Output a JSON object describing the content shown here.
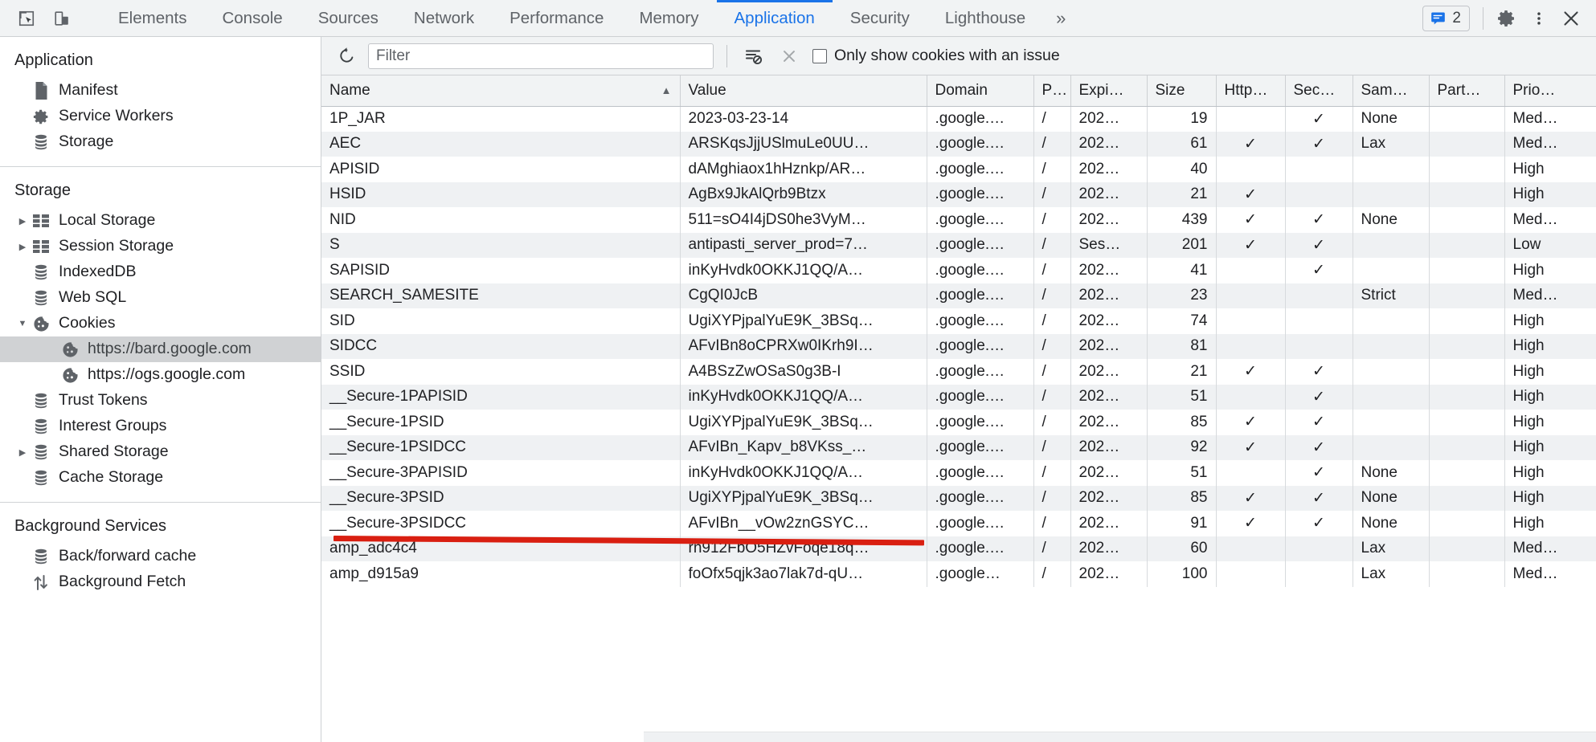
{
  "toolbar": {
    "inspect_icon": "inspect-cursor-icon",
    "device_icon": "device-toolbar-icon",
    "tabs": [
      {
        "label": "Elements",
        "selected": false
      },
      {
        "label": "Console",
        "selected": false
      },
      {
        "label": "Sources",
        "selected": false
      },
      {
        "label": "Network",
        "selected": false
      },
      {
        "label": "Performance",
        "selected": false
      },
      {
        "label": "Memory",
        "selected": false
      },
      {
        "label": "Application",
        "selected": true
      },
      {
        "label": "Security",
        "selected": false
      },
      {
        "label": "Lighthouse",
        "selected": false
      }
    ],
    "more_tabs": "»",
    "issues_count": "2",
    "settings_icon": "gear-icon",
    "menu_icon": "kebab-menu-icon",
    "close_icon": "close-icon",
    "accent_color": "#1a73e8"
  },
  "sidebar": {
    "groups": [
      {
        "title": "Application",
        "items": [
          {
            "label": "Manifest",
            "icon": "manifest-document-icon",
            "indent": 1,
            "twisty": "",
            "selected": false
          },
          {
            "label": "Service Workers",
            "icon": "gear-icon",
            "indent": 1,
            "twisty": "",
            "selected": false
          },
          {
            "label": "Storage",
            "icon": "database-icon",
            "indent": 1,
            "twisty": "",
            "selected": false
          }
        ]
      },
      {
        "title": "Storage",
        "items": [
          {
            "label": "Local Storage",
            "icon": "table-grid-icon",
            "indent": 1,
            "twisty": "▶",
            "selected": false
          },
          {
            "label": "Session Storage",
            "icon": "table-grid-icon",
            "indent": 1,
            "twisty": "▶",
            "selected": false
          },
          {
            "label": "IndexedDB",
            "icon": "database-icon",
            "indent": 1,
            "twisty": "",
            "selected": false
          },
          {
            "label": "Web SQL",
            "icon": "database-icon",
            "indent": 1,
            "twisty": "",
            "selected": false
          },
          {
            "label": "Cookies",
            "icon": "cookie-icon",
            "indent": 1,
            "twisty": "▼",
            "selected": false
          },
          {
            "label": "https://bard.google.com",
            "icon": "cookie-icon",
            "indent": 2,
            "twisty": "",
            "selected": true
          },
          {
            "label": "https://ogs.google.com",
            "icon": "cookie-icon",
            "indent": 2,
            "twisty": "",
            "selected": false
          },
          {
            "label": "Trust Tokens",
            "icon": "database-icon",
            "indent": 1,
            "twisty": "",
            "selected": false
          },
          {
            "label": "Interest Groups",
            "icon": "database-icon",
            "indent": 1,
            "twisty": "",
            "selected": false
          },
          {
            "label": "Shared Storage",
            "icon": "database-icon",
            "indent": 1,
            "twisty": "▶",
            "selected": false
          },
          {
            "label": "Cache Storage",
            "icon": "database-icon",
            "indent": 1,
            "twisty": "",
            "selected": false
          }
        ]
      },
      {
        "title": "Background Services",
        "items": [
          {
            "label": "Back/forward cache",
            "icon": "database-icon",
            "indent": 1,
            "twisty": "",
            "selected": false
          },
          {
            "label": "Background Fetch",
            "icon": "updown-arrows-icon",
            "indent": 1,
            "twisty": "",
            "selected": false
          }
        ]
      }
    ]
  },
  "filter_bar": {
    "refresh_icon": "refresh-icon",
    "filter_placeholder": "Filter",
    "filter_value": "",
    "clear_filtered_icon": "clear-filtered-cookies-icon",
    "clear_all_icon": "clear-all-cookies-icon",
    "only_issues_label": "Only show cookies with an issue",
    "only_issues_checked": false
  },
  "table": {
    "sort_column": "Name",
    "sort_direction": "asc",
    "sort_arrow": "▲",
    "columns": [
      {
        "label": "Name",
        "key": "name",
        "align": "left"
      },
      {
        "label": "Value",
        "key": "value",
        "align": "left"
      },
      {
        "label": "Domain",
        "key": "domain",
        "align": "left"
      },
      {
        "label": "P…",
        "key": "path",
        "align": "left"
      },
      {
        "label": "Expi…",
        "key": "expires",
        "align": "left"
      },
      {
        "label": "Size",
        "key": "size",
        "align": "right"
      },
      {
        "label": "Http…",
        "key": "httponly",
        "align": "center"
      },
      {
        "label": "Sec…",
        "key": "secure",
        "align": "center"
      },
      {
        "label": "Sam…",
        "key": "samesite",
        "align": "left"
      },
      {
        "label": "Part…",
        "key": "partition",
        "align": "left"
      },
      {
        "label": "Prio…",
        "key": "priority",
        "align": "left"
      }
    ],
    "rows": [
      {
        "name": "1P_JAR",
        "value": "2023-03-23-14",
        "domain": ".google.…",
        "path": "/",
        "expires": "202…",
        "size": "19",
        "httponly": "",
        "secure": "✓",
        "samesite": "None",
        "partition": "",
        "priority": "Med…"
      },
      {
        "name": "AEC",
        "value": "ARSKqsJjjUSlmuLe0UU…",
        "domain": ".google.…",
        "path": "/",
        "expires": "202…",
        "size": "61",
        "httponly": "✓",
        "secure": "✓",
        "samesite": "Lax",
        "partition": "",
        "priority": "Med…"
      },
      {
        "name": "APISID",
        "value": "dAMghiaox1hHznkp/AR…",
        "domain": ".google.…",
        "path": "/",
        "expires": "202…",
        "size": "40",
        "httponly": "",
        "secure": "",
        "samesite": "",
        "partition": "",
        "priority": "High"
      },
      {
        "name": "HSID",
        "value": "AgBx9JkAlQrb9Btzx",
        "domain": ".google.…",
        "path": "/",
        "expires": "202…",
        "size": "21",
        "httponly": "✓",
        "secure": "",
        "samesite": "",
        "partition": "",
        "priority": "High"
      },
      {
        "name": "NID",
        "value": "511=sO4I4jDS0he3VyM…",
        "domain": ".google.…",
        "path": "/",
        "expires": "202…",
        "size": "439",
        "httponly": "✓",
        "secure": "✓",
        "samesite": "None",
        "partition": "",
        "priority": "Med…"
      },
      {
        "name": "S",
        "value": "antipasti_server_prod=7…",
        "domain": ".google.…",
        "path": "/",
        "expires": "Ses…",
        "size": "201",
        "httponly": "✓",
        "secure": "✓",
        "samesite": "",
        "partition": "",
        "priority": "Low"
      },
      {
        "name": "SAPISID",
        "value": "inKyHvdk0OKKJ1QQ/A…",
        "domain": ".google.…",
        "path": "/",
        "expires": "202…",
        "size": "41",
        "httponly": "",
        "secure": "✓",
        "samesite": "",
        "partition": "",
        "priority": "High"
      },
      {
        "name": "SEARCH_SAMESITE",
        "value": "CgQI0JcB",
        "domain": ".google.…",
        "path": "/",
        "expires": "202…",
        "size": "23",
        "httponly": "",
        "secure": "",
        "samesite": "Strict",
        "partition": "",
        "priority": "Med…"
      },
      {
        "name": "SID",
        "value": "UgiXYPjpalYuE9K_3BSq…",
        "domain": ".google.…",
        "path": "/",
        "expires": "202…",
        "size": "74",
        "httponly": "",
        "secure": "",
        "samesite": "",
        "partition": "",
        "priority": "High"
      },
      {
        "name": "SIDCC",
        "value": "AFvIBn8oCPRXw0IKrh9I…",
        "domain": ".google.…",
        "path": "/",
        "expires": "202…",
        "size": "81",
        "httponly": "",
        "secure": "",
        "samesite": "",
        "partition": "",
        "priority": "High"
      },
      {
        "name": "SSID",
        "value": "A4BSzZwOSaS0g3B-I",
        "domain": ".google.…",
        "path": "/",
        "expires": "202…",
        "size": "21",
        "httponly": "✓",
        "secure": "✓",
        "samesite": "",
        "partition": "",
        "priority": "High"
      },
      {
        "name": "__Secure-1PAPISID",
        "value": "inKyHvdk0OKKJ1QQ/A…",
        "domain": ".google.…",
        "path": "/",
        "expires": "202…",
        "size": "51",
        "httponly": "",
        "secure": "✓",
        "samesite": "",
        "partition": "",
        "priority": "High"
      },
      {
        "name": "__Secure-1PSID",
        "value": "UgiXYPjpalYuE9K_3BSq…",
        "domain": ".google.…",
        "path": "/",
        "expires": "202…",
        "size": "85",
        "httponly": "✓",
        "secure": "✓",
        "samesite": "",
        "partition": "",
        "priority": "High"
      },
      {
        "name": "__Secure-1PSIDCC",
        "value": "AFvIBn_Kapv_b8VKss_…",
        "domain": ".google.…",
        "path": "/",
        "expires": "202…",
        "size": "92",
        "httponly": "✓",
        "secure": "✓",
        "samesite": "",
        "partition": "",
        "priority": "High"
      },
      {
        "name": "__Secure-3PAPISID",
        "value": "inKyHvdk0OKKJ1QQ/A…",
        "domain": ".google.…",
        "path": "/",
        "expires": "202…",
        "size": "51",
        "httponly": "",
        "secure": "✓",
        "samesite": "None",
        "partition": "",
        "priority": "High"
      },
      {
        "name": "__Secure-3PSID",
        "value": "UgiXYPjpalYuE9K_3BSq…",
        "domain": ".google.…",
        "path": "/",
        "expires": "202…",
        "size": "85",
        "httponly": "✓",
        "secure": "✓",
        "samesite": "None",
        "partition": "",
        "priority": "High"
      },
      {
        "name": "__Secure-3PSIDCC",
        "value": "AFvIBn__vOw2znGSYC…",
        "domain": ".google.…",
        "path": "/",
        "expires": "202…",
        "size": "91",
        "httponly": "✓",
        "secure": "✓",
        "samesite": "None",
        "partition": "",
        "priority": "High"
      },
      {
        "name": "amp_adc4c4",
        "value": "rn912FbO5HZvFoqe18q…",
        "domain": ".google.…",
        "path": "/",
        "expires": "202…",
        "size": "60",
        "httponly": "",
        "secure": "",
        "samesite": "Lax",
        "partition": "",
        "priority": "Med…"
      },
      {
        "name": "amp_d915a9",
        "value": "foOfx5qjk3ao7lak7d-qU…",
        "domain": ".google…",
        "path": "/",
        "expires": "202…",
        "size": "100",
        "httponly": "",
        "secure": "",
        "samesite": "Lax",
        "partition": "",
        "priority": "Med…"
      }
    ]
  },
  "annotation": {
    "type": "red-underline",
    "target_row": "__Secure-1PSID",
    "color": "#d91f11"
  }
}
